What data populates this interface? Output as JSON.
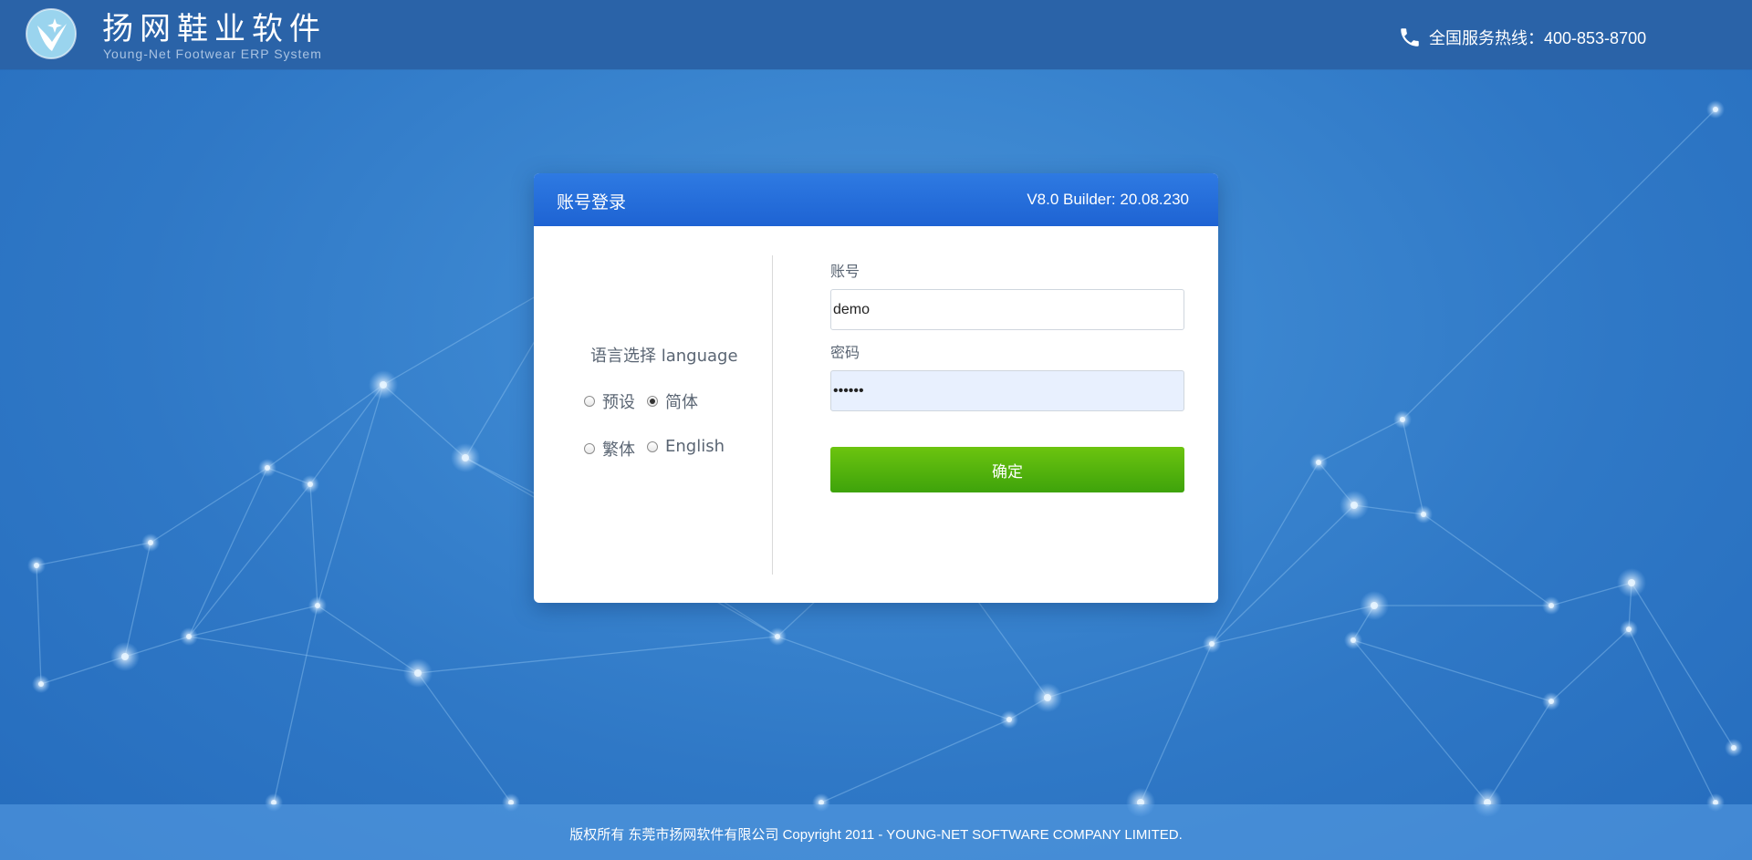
{
  "header": {
    "brand_title": "扬网鞋业软件",
    "brand_subtitle": "Young-Net Footwear ERP System",
    "hotline": "全国服务热线：400-853-8700",
    "logo_icon": "brand-logo-icon",
    "phone_icon": "phone-icon"
  },
  "login": {
    "title": "账号登录",
    "version": "V8.0 Builder: 20.08.230",
    "language": {
      "title": "语言选择 language",
      "options": [
        {
          "label": "预设",
          "checked": false
        },
        {
          "label": "简体",
          "checked": true
        },
        {
          "label": "繁体",
          "checked": false
        },
        {
          "label": "English",
          "checked": false
        }
      ]
    },
    "account_label": "账号",
    "account_value": "demo",
    "password_label": "密码",
    "password_value": "123456",
    "submit_label": "确定"
  },
  "footer": {
    "copyright": "版权所有 东莞市扬网软件有限公司 Copyright 2011 - YOUNG-NET SOFTWARE COMPANY LIMITED."
  },
  "colors": {
    "header_bg": "#2a63a8",
    "panel_header": "#2e7ae2",
    "submit_green": "#4fb20d"
  }
}
